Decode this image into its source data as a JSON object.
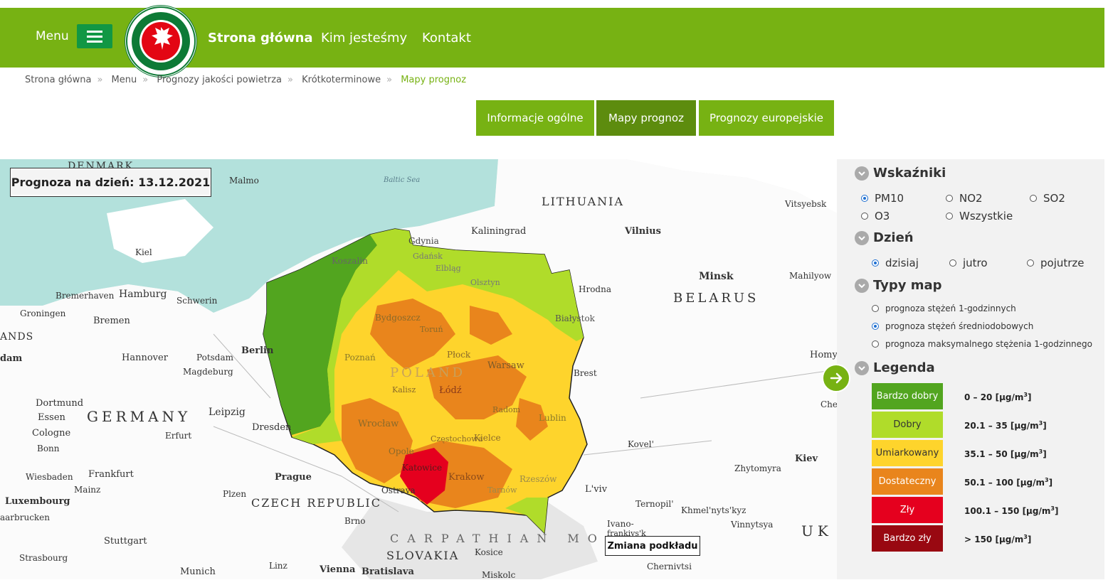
{
  "header": {
    "menu_label": "Menu",
    "logo_text_top": "INSPEKCJA",
    "logo_text_bottom": "OCHRONY ŚRODOWISKA",
    "nav": [
      {
        "label": "Strona główna"
      },
      {
        "label": "Kim jesteśmy"
      },
      {
        "label": "Kontakt"
      }
    ]
  },
  "breadcrumb": [
    "Strona główna",
    "Menu",
    "Prognozy jakości powietrza",
    "Krótkoterminowe",
    "Mapy prognoz"
  ],
  "tabs": [
    {
      "label": "Informacje ogólne",
      "active": false
    },
    {
      "label": "Mapy prognoz",
      "active": true
    },
    {
      "label": "Prognozy europejskie",
      "active": false
    }
  ],
  "map": {
    "forecast_label": "Prognoza na dzień: 13.12.2021",
    "basemap_button": "Zmiana podkładu",
    "labels": {
      "denmark": "DENMARK",
      "malmo": "Malmo",
      "baltic": "Baltic Sea",
      "lithuania": "LITHUANIA",
      "kaliningrad": "Kaliningrad",
      "vilnius": "Vilnius",
      "vitsyebsk": "Vitsyebsk",
      "kiel": "Kiel",
      "gdynia": "Gdynia",
      "gdansk": "Gdańsk",
      "koszalin": "Koszalin",
      "elblag": "Elbląg",
      "olsztyn": "Olsztyn",
      "minsk": "Minsk",
      "mahilyow": "Mahilyow",
      "bremerhaven": "Bremerhaven",
      "hamburg": "Hamburg",
      "schwerin": "Schwerin",
      "hrodna": "Hrodna",
      "belarus": "BELARUS",
      "groningen": "Groningen",
      "bremen": "Bremen",
      "bialystok": "Białystok",
      "bydgoszcz": "Bydgoszcz",
      "torun": "Toruń",
      "ands": "ANDS",
      "dam": "dam",
      "berlin": "Berlin",
      "hanover": "Hannover",
      "potsdam": "Potsdam",
      "magdeburg": "Magdeburg",
      "poland": "POLAND",
      "warsaw": "Warsaw",
      "poznan": "Poznań",
      "plock": "Płock",
      "brest": "Brest",
      "homyel": "Homy",
      "lodz": "Łódź",
      "kalisz": "Kalisz",
      "radom": "Radom",
      "dortmund": "Dortmund",
      "essen": "Essen",
      "germany": "GERMANY",
      "leipzig": "Leipzig",
      "lublin": "Lublin",
      "cologne": "Cologne",
      "erfurt": "Erfurt",
      "dresden": "Dresden",
      "wroclaw": "Wrocław",
      "kielce": "Kielce",
      "czestochowa": "Częstochowa",
      "kovel": "Kovel'",
      "kiev": "Kiev",
      "bonn": "Bonn",
      "opole": "Opole",
      "katowice": "Katowice",
      "krakow": "Krakow",
      "rzeszow": "Rzeszów",
      "wiesbaden": "Wiesbaden",
      "frankfurt": "Frankfurt",
      "prague": "Prague",
      "zhytomyra": "Zhytomyra",
      "mainz": "Mainz",
      "plzen": "Plzen",
      "ostrava": "Ostrava",
      "tarnow": "Tarnów",
      "lviv": "L'viv",
      "luxembourg": "Luxembourg",
      "czech": "CZECH REPUBLIC",
      "ternopil": "Ternopil'",
      "khmelnytskyi": "Khmel'nyts'kyz",
      "vinnytsya": "Vinnytsya",
      "saarbrucken": "aarbrucken",
      "brno": "Brno",
      "ivano": "Ivano-",
      "ivano2": "frankivs'k",
      "stuttgart": "Stuttgart",
      "carpathian": "CARPATHIAN MO",
      "uk": "UK",
      "slovakia": "SLOVAKIA",
      "kosice": "Kosice",
      "strasbourg": "Strasbourg",
      "munich": "Munich",
      "linz": "Linz",
      "vienna": "Vienna",
      "bratislava": "Bratislava",
      "chernivtsi": "Chernivtsi",
      "miskolc": "Miskolc",
      "cherkasy": "Che"
    }
  },
  "panel": {
    "indicators": {
      "title": "Wskaźniki",
      "options": [
        {
          "label": "PM10",
          "checked": true
        },
        {
          "label": "NO2",
          "checked": false
        },
        {
          "label": "SO2",
          "checked": false
        },
        {
          "label": "O3",
          "checked": false
        },
        {
          "label": "Wszystkie",
          "checked": false
        }
      ]
    },
    "day": {
      "title": "Dzień",
      "options": [
        {
          "label": "dzisiaj",
          "checked": true
        },
        {
          "label": "jutro",
          "checked": false
        },
        {
          "label": "pojutrze",
          "checked": false
        }
      ]
    },
    "map_types": {
      "title": "Typy map",
      "options": [
        {
          "label": "prognoza stężeń 1-godzinnych",
          "checked": false
        },
        {
          "label": "prognoza stężeń średniodobowych",
          "checked": true
        },
        {
          "label": "prognoza maksymalnego stężenia 1-godzinnego",
          "checked": false
        }
      ]
    },
    "legend": {
      "title": "Legenda",
      "unit": "[μg/m",
      "unit_exp": "3",
      "unit_close": "]",
      "items": [
        {
          "label": "Bardzo dobry",
          "range": "0 – 20",
          "color": "#52a51f",
          "text_color": "#ffffff"
        },
        {
          "label": "Dobry",
          "range": "20.1 – 35",
          "color": "#b0dc2a",
          "text_color": "#333333"
        },
        {
          "label": "Umiarkowany",
          "range": "35.1 – 50",
          "color": "#fed42c",
          "text_color": "#333333"
        },
        {
          "label": "Dostateczny",
          "range": "50.1 – 100",
          "color": "#e9851c",
          "text_color": "#ffffff"
        },
        {
          "label": "Zły",
          "range": "100.1 – 150",
          "color": "#e5001e",
          "text_color": "#ffffff"
        },
        {
          "label": "Bardzo zły",
          "range": "> 150",
          "color": "#990811",
          "text_color": "#ffffff"
        }
      ]
    }
  }
}
